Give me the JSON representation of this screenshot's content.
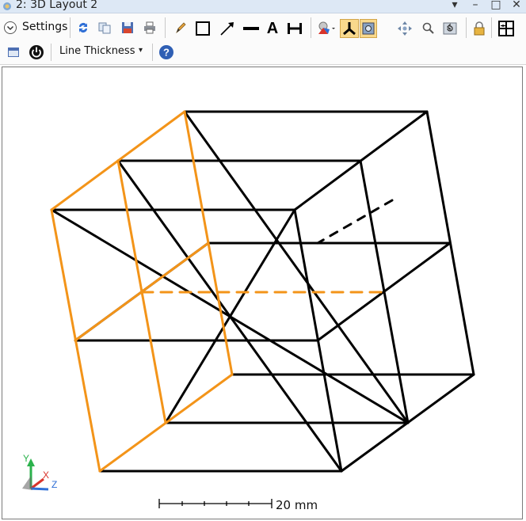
{
  "window": {
    "title": "2: 3D Layout 2",
    "controls": [
      "▾",
      "–",
      "□",
      "✕"
    ]
  },
  "toolbar": {
    "settings_label": "Settings",
    "line_thickness_label": "Line Thickness",
    "line_thickness_arrow": "▾",
    "text_tool_label": "A"
  },
  "viewer": {
    "scale_label": "20 mm",
    "axis_y_label": "Y",
    "axis_x_label": "X",
    "axis_z_label": "Z",
    "colors": {
      "wire": "#000000",
      "highlight": "#f39419",
      "axis_y": "#2bb24c",
      "axis_x": "#d9342b",
      "axis_z": "#2f6fd6"
    }
  }
}
